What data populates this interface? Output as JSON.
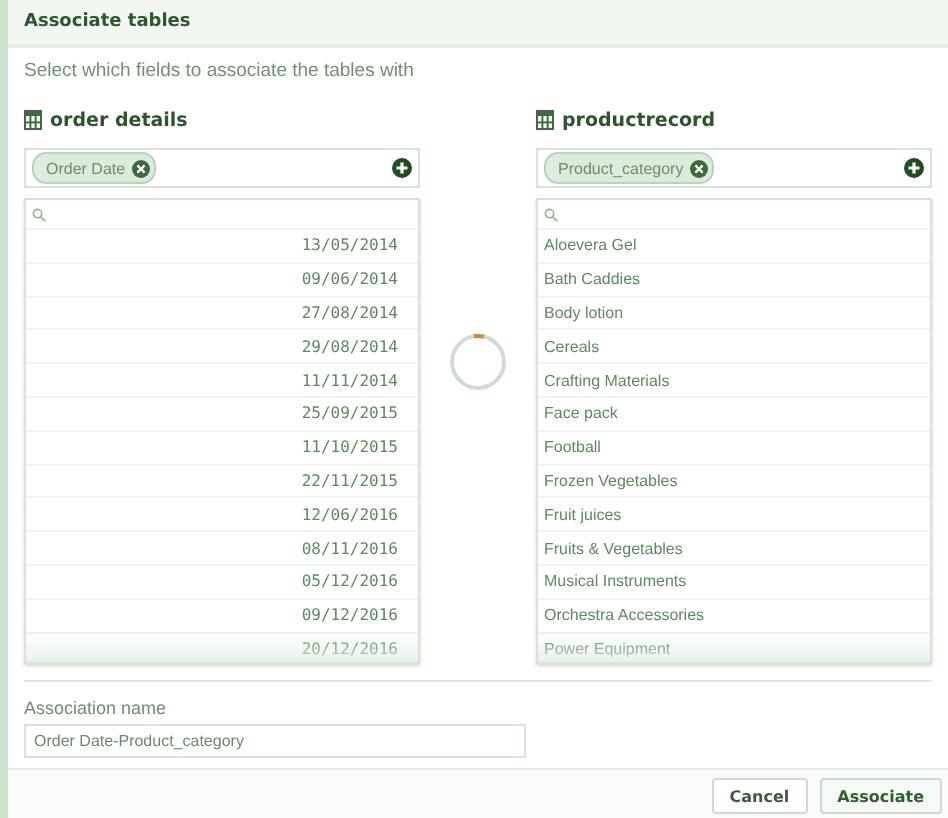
{
  "dialog": {
    "title": "Associate tables",
    "instruction": "Select which fields to associate the tables with"
  },
  "tables": [
    {
      "name": "order details",
      "kind": "date",
      "fields": [
        {
          "label": "Order Date"
        }
      ],
      "values": [
        "13/05/2014",
        "09/06/2014",
        "27/08/2014",
        "29/08/2014",
        "11/11/2014",
        "25/09/2015",
        "11/10/2015",
        "22/11/2015",
        "12/06/2016",
        "08/11/2016",
        "05/12/2016",
        "09/12/2016",
        "20/12/2016"
      ]
    },
    {
      "name": "productrecord",
      "kind": "text",
      "fields": [
        {
          "label": "Product_category"
        }
      ],
      "values": [
        "Aloevera Gel",
        "Bath Caddies",
        "Body lotion",
        "Cereals",
        "Crafting Materials",
        "Face pack",
        "Football",
        "Frozen Vegetables",
        "Fruit juices",
        "Fruits & Vegetables",
        "Musical Instruments",
        "Orchestra Accessories",
        "Power Equipment"
      ]
    }
  ],
  "association": {
    "label": "Association name",
    "value": "Order Date-Product_category"
  },
  "buttons": [
    {
      "label": "Cancel",
      "kind": "secondary"
    },
    {
      "label": "Associate",
      "kind": "primary"
    }
  ]
}
